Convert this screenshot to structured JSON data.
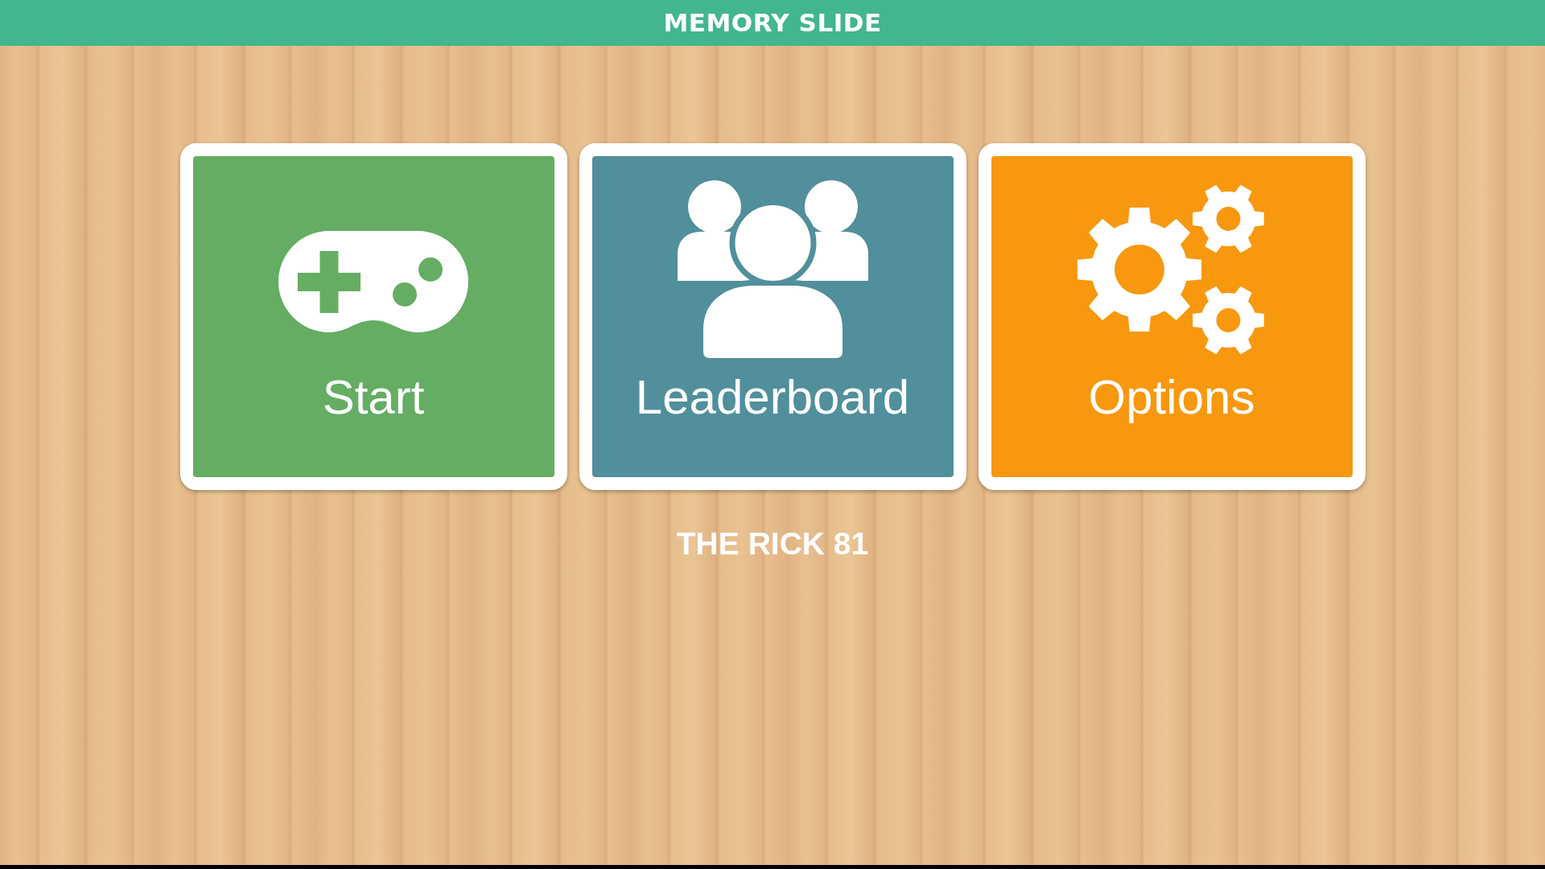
{
  "header": {
    "title": "MEMORY SLIDE"
  },
  "menu": [
    {
      "label": "Start",
      "kind": "controller",
      "color": "#64ad63"
    },
    {
      "label": "Leaderboard",
      "kind": "people",
      "color": "#508f9b"
    },
    {
      "label": "Options",
      "kind": "gears",
      "color": "#f8980f"
    }
  ],
  "player_name": "THE RICK 81"
}
